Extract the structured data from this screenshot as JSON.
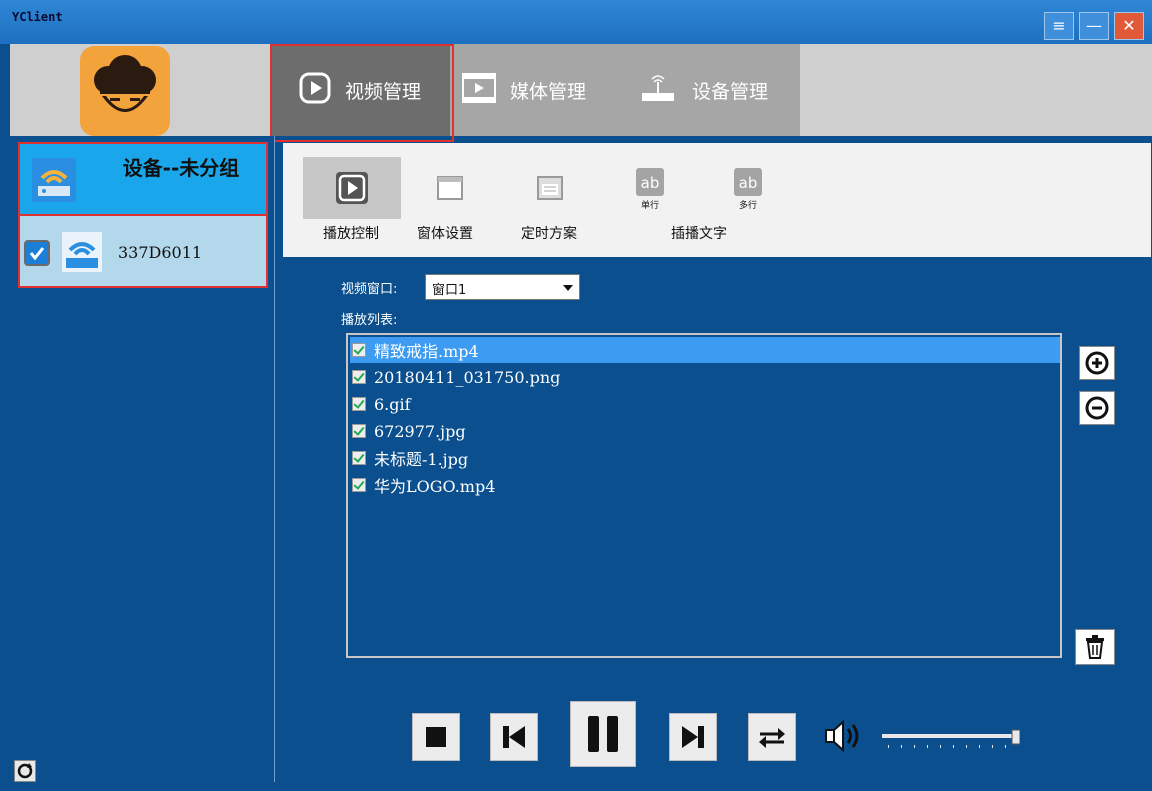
{
  "window": {
    "title": "YClient"
  },
  "nav": {
    "tabs": [
      {
        "label": "视频管理",
        "icon": "play-icon",
        "active": true
      },
      {
        "label": "媒体管理",
        "icon": "film-icon",
        "active": false
      },
      {
        "label": "设备管理",
        "icon": "router-icon",
        "active": false
      }
    ]
  },
  "sidebar": {
    "group_title": "设备--未分组",
    "device": {
      "name": "337D6011",
      "checked": true
    }
  },
  "toolbar": {
    "tools": [
      {
        "label": "播放控制",
        "icon": "play-icon",
        "active": true
      },
      {
        "label": "窗体设置",
        "icon": "window-icon",
        "active": false
      },
      {
        "label": "定时方案",
        "icon": "calendar-icon",
        "active": false
      },
      {
        "label": "单行",
        "icon": "ab-text-icon",
        "active": false
      },
      {
        "label": "多行",
        "icon": "ab-text-icon",
        "active": false
      }
    ],
    "insert_text_label": "插播文字"
  },
  "video_window": {
    "label": "视频窗口:",
    "selected": "窗口1"
  },
  "playlist": {
    "label": "播放列表:",
    "items": [
      {
        "name": "精致戒指.mp4",
        "checked": true,
        "selected": true
      },
      {
        "name": "20180411_031750.png",
        "checked": true,
        "selected": false
      },
      {
        "name": "6.gif",
        "checked": true,
        "selected": false
      },
      {
        "name": "672977.jpg",
        "checked": true,
        "selected": false
      },
      {
        "name": "未标题-1.jpg",
        "checked": true,
        "selected": false
      },
      {
        "name": "华为LOGO.mp4",
        "checked": true,
        "selected": false
      }
    ]
  },
  "playback": {
    "volume": 1.0
  },
  "colors": {
    "accent": "#1aa6ea",
    "background": "#0b4f8f",
    "highlight_border": "#e03030"
  }
}
